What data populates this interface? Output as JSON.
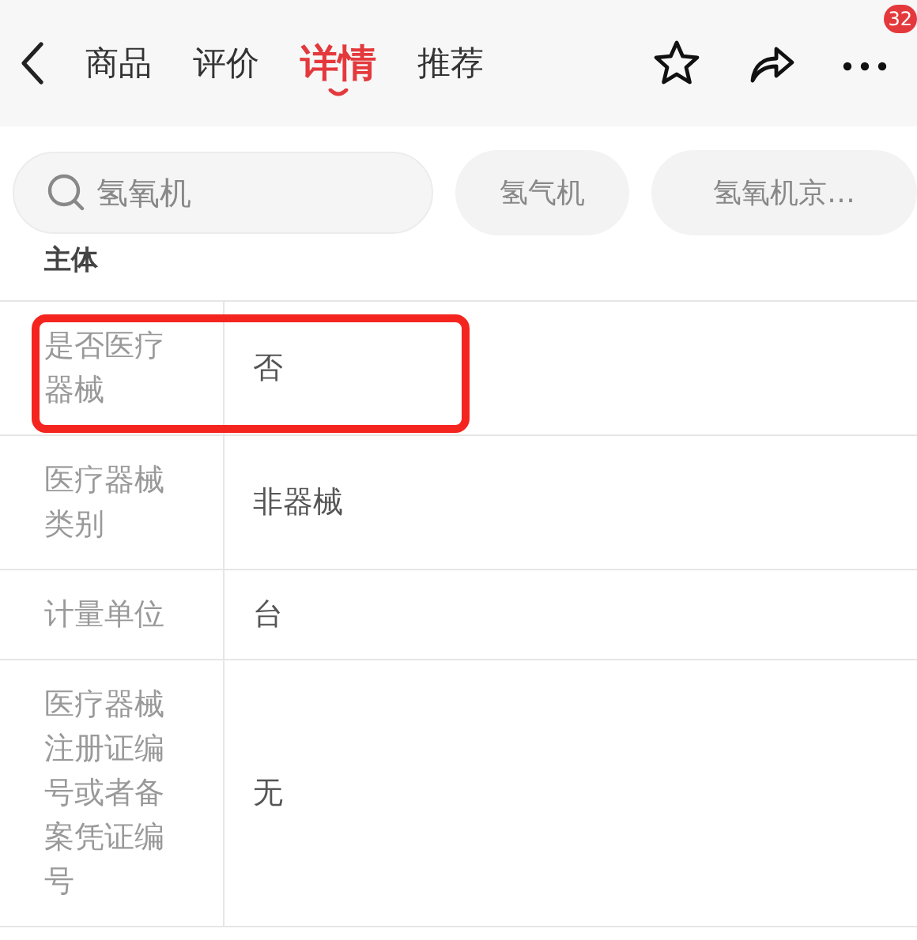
{
  "nav": {
    "tabs": [
      {
        "label": "商品",
        "selected": false
      },
      {
        "label": "评价",
        "selected": false
      },
      {
        "label": "详情",
        "selected": true
      },
      {
        "label": "推荐",
        "selected": false
      }
    ],
    "badge": "32"
  },
  "search": {
    "placeholder": "氢氧机",
    "suggestions": [
      "氢气机",
      "氢氧机京…"
    ]
  },
  "section": {
    "title": "主体"
  },
  "rows": [
    {
      "label": "是否医疗器械",
      "value": "否",
      "highlighted": true
    },
    {
      "label": "医疗器械类别",
      "value": "非器械",
      "highlighted": false
    },
    {
      "label": "计量单位",
      "value": "台",
      "highlighted": false
    },
    {
      "label": "医疗器械注册证编号或者备案凭证编号",
      "value": "无",
      "highlighted": false
    }
  ]
}
